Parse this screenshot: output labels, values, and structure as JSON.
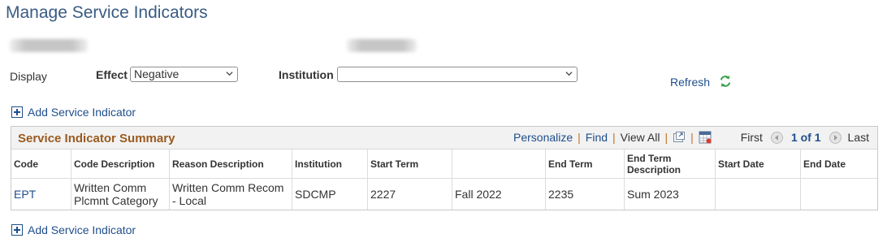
{
  "page": {
    "title": "Manage Service Indicators"
  },
  "filters": {
    "display_label": "Display",
    "effect_label": "Effect",
    "effect_value": "Negative",
    "institution_label": "Institution",
    "institution_value": "",
    "refresh_label": "Refresh"
  },
  "add_label": "Add Service Indicator",
  "grid": {
    "title": "Service Indicator Summary",
    "personalize": "Personalize",
    "find": "Find",
    "view_all": "View All",
    "first": "First",
    "range": "1 of 1",
    "last": "Last",
    "columns": [
      "Code",
      "Code Description",
      "Reason Description",
      "Institution",
      "Start Term",
      "",
      "End Term",
      "End Term Description",
      "Start Date",
      "End Date"
    ],
    "rows": [
      {
        "code": "EPT",
        "code_description": "Written Comm Plcmnt Category",
        "reason_description": "Written Comm Recom - Local",
        "institution": "SDCMP",
        "start_term": "2227",
        "start_term_description": "Fall 2022",
        "end_term": "2235",
        "end_term_description": "Sum 2023",
        "start_date": "",
        "end_date": ""
      }
    ]
  },
  "colors": {
    "title": "#3a5b83",
    "link": "#1f4e8c",
    "grid_title": "#9a5a1e",
    "refresh_icon": "#3aa14a"
  },
  "icons": [
    "refresh-icon",
    "add-icon",
    "zoom-icon",
    "download-icon",
    "first-arrow-icon",
    "last-arrow-icon",
    "chevron-down-icon"
  ]
}
